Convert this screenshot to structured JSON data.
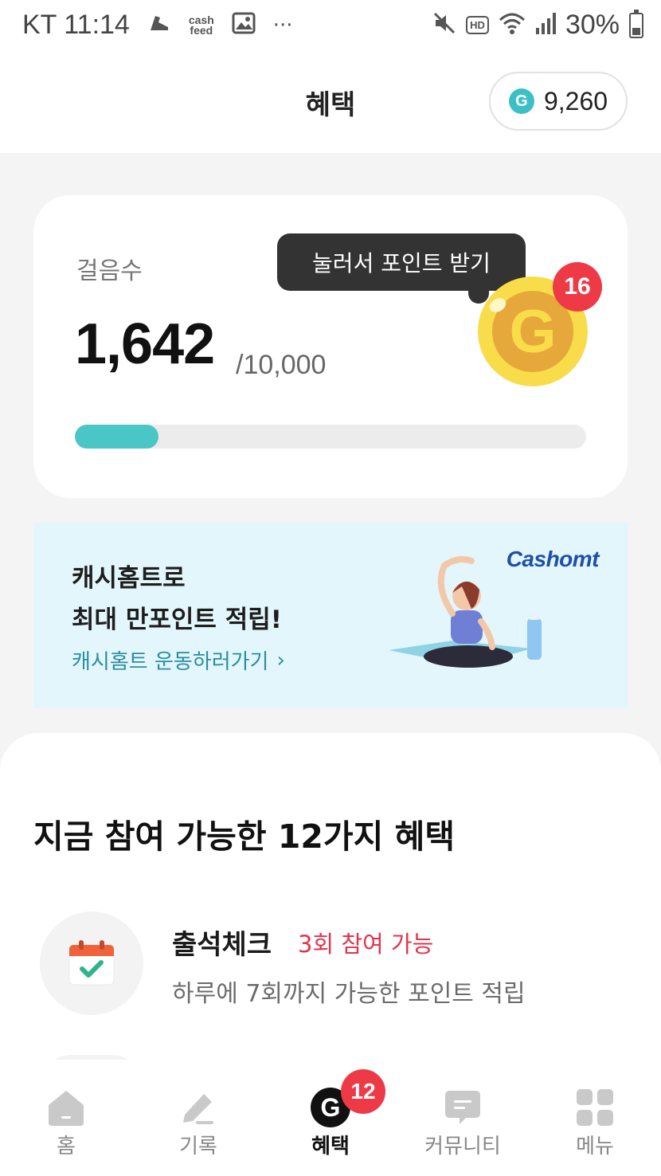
{
  "status_bar": {
    "carrier_time": "KT 11:14",
    "notif_icons": [
      "running-shoe-icon",
      "cashfeed-icon",
      "image-icon",
      "more-dots-icon"
    ],
    "cashfeed_text": "cash\nfeed",
    "more": "···",
    "right_icons": [
      "mute-icon",
      "hd-icon",
      "wifi-icon",
      "signal-icon"
    ],
    "hd_label": "HD",
    "battery": "30%"
  },
  "header": {
    "title": "혜택",
    "points_icon_letter": "G",
    "points": "9,260"
  },
  "steps": {
    "label": "걸음수",
    "count": "1,642",
    "goal": "/10,000",
    "progress": 0.164,
    "tooltip": "눌러서 포인트 받기",
    "coin_letter": "G",
    "coin_count": "16"
  },
  "banner": {
    "title_line1": "캐시홈트로",
    "title_line2": "최대 만포인트 적립!",
    "link": "캐시홈트 운동하러가기",
    "link_chevron": "›",
    "logo": "Cashomt"
  },
  "benefits": {
    "title": "지금 참여 가능한 12가지 혜택",
    "items": [
      {
        "icon": "calendar-check-icon",
        "name": "출석체크",
        "badge": "3회 참여 가능",
        "desc": "하루에 7회까지 가능한 포인트 적립"
      }
    ]
  },
  "bottom_nav": {
    "items": [
      {
        "label": "홈",
        "icon": "home-icon"
      },
      {
        "label": "기록",
        "icon": "pencil-icon"
      },
      {
        "label": "혜택",
        "icon": "g-coin-icon",
        "badge": "12",
        "active": true
      },
      {
        "label": "커뮤니티",
        "icon": "chat-icon"
      },
      {
        "label": "메뉴",
        "icon": "grid-icon"
      }
    ],
    "benefit_icon_letter": "G"
  },
  "colors": {
    "accent_teal": "#4ac6c6",
    "badge_red": "#ee3a46",
    "banner_bg": "#e3f6fb",
    "coin_yellow": "#f8dc4a"
  }
}
